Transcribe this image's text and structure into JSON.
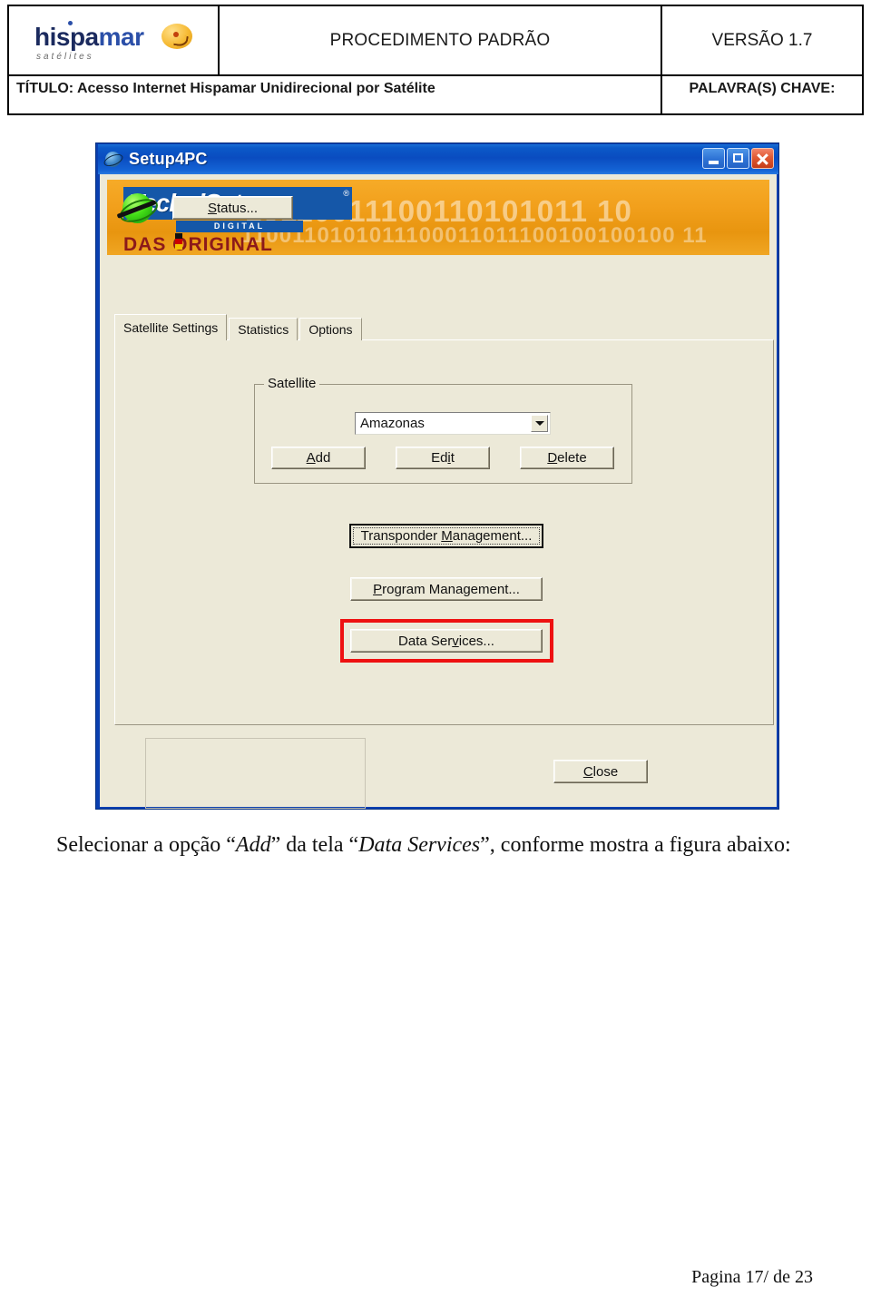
{
  "doc_header": {
    "logo": {
      "part1": "hispa",
      "part2": "mar",
      "subtitle": "satélites"
    },
    "center_title": "PROCEDIMENTO PADRÃO",
    "version": "VERSÃO 1.7",
    "titulo": "TÍTULO: Acesso Internet Hispamar Unidirecional por Satélite",
    "keywords_label": "PALAVRA(S) CHAVE:"
  },
  "window": {
    "title": "Setup4PC",
    "icon": "globe-icon",
    "buttons": {
      "minimize": "minimize-icon",
      "maximize": "maximize-icon",
      "close": "close-icon"
    },
    "banner": {
      "brand": "TechniSat",
      "registered": "®",
      "digital": "DIGITAL",
      "tagline": "DAS ORIGINAL",
      "binary_row1": "10110011100110101011 10",
      "binary_row2": "1100110101011100011011100100100100 11",
      "background_color": "#f2a01c"
    },
    "tabs": [
      {
        "label": "Satellite Settings",
        "active": true
      },
      {
        "label": "Statistics",
        "active": false
      },
      {
        "label": "Options",
        "active": false
      }
    ],
    "satellite_group": {
      "legend": "Satellite",
      "combo_value": "Amazonas",
      "combo_arrow": "chevron-down-icon",
      "buttons": {
        "add": {
          "pre": "A",
          "mnemonic": "",
          "post": "dd",
          "label": "Add"
        },
        "edit": {
          "label": "Edit"
        },
        "delete": {
          "label": "Delete"
        }
      }
    },
    "management_buttons": {
      "transponder": "Transponder Management...",
      "program": "Program Management...",
      "data_services": "Data Services..."
    },
    "highlight_color": "#ee1111",
    "status_area": {
      "icon": "satellite-globe-icon",
      "status_button": "Status...",
      "close_button": "Close"
    }
  },
  "caption": {
    "part1": "Selecionar a opção “",
    "em1": "Add",
    "part2": "” da tela “",
    "em2": "Data Services",
    "part3": "”, conforme mostra a figura abaixo:"
  },
  "footer": {
    "page": "Pagina 17/ de 23"
  }
}
